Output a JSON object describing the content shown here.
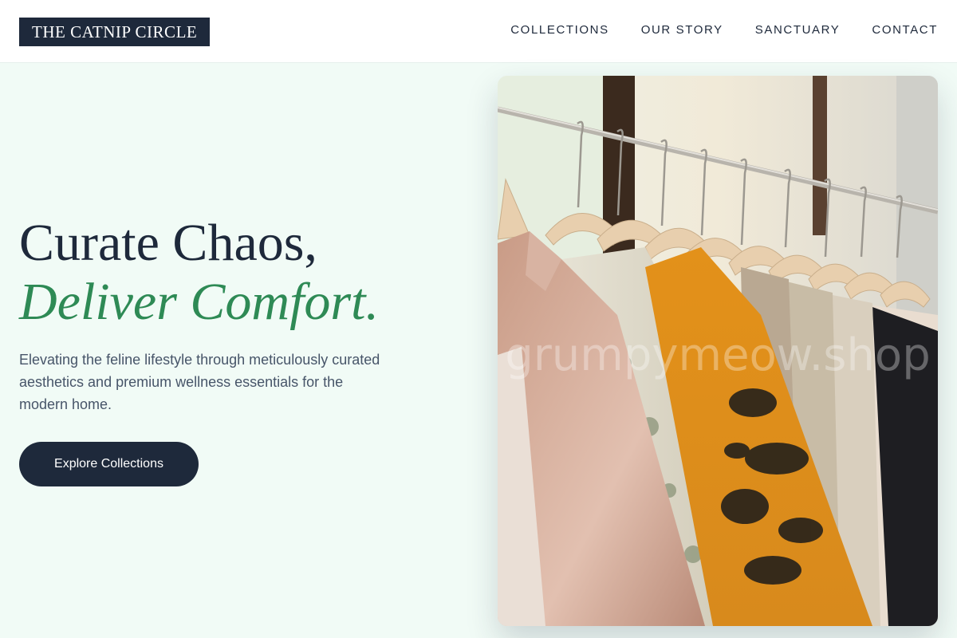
{
  "brand": {
    "name": "THE CATNIP CIRCLE",
    "colors": {
      "primary": "#1e293b",
      "accent": "#2e8a55",
      "background": "#f1fbf6",
      "text_muted": "#475569"
    }
  },
  "nav": {
    "items": [
      {
        "label": "COLLECTIONS"
      },
      {
        "label": "OUR STORY"
      },
      {
        "label": "SANCTUARY"
      },
      {
        "label": "CONTACT"
      }
    ]
  },
  "hero": {
    "title_line1": "Curate Chaos,",
    "title_line2": "Deliver Comfort.",
    "description": "Elevating the feline lifestyle through meticulously curated aesthetics and premium wellness essentials for the modern home.",
    "cta_label": "Explore Collections",
    "image": {
      "watermark": "grumpymeow.shop",
      "icon": "clothing-rack-photo"
    }
  }
}
